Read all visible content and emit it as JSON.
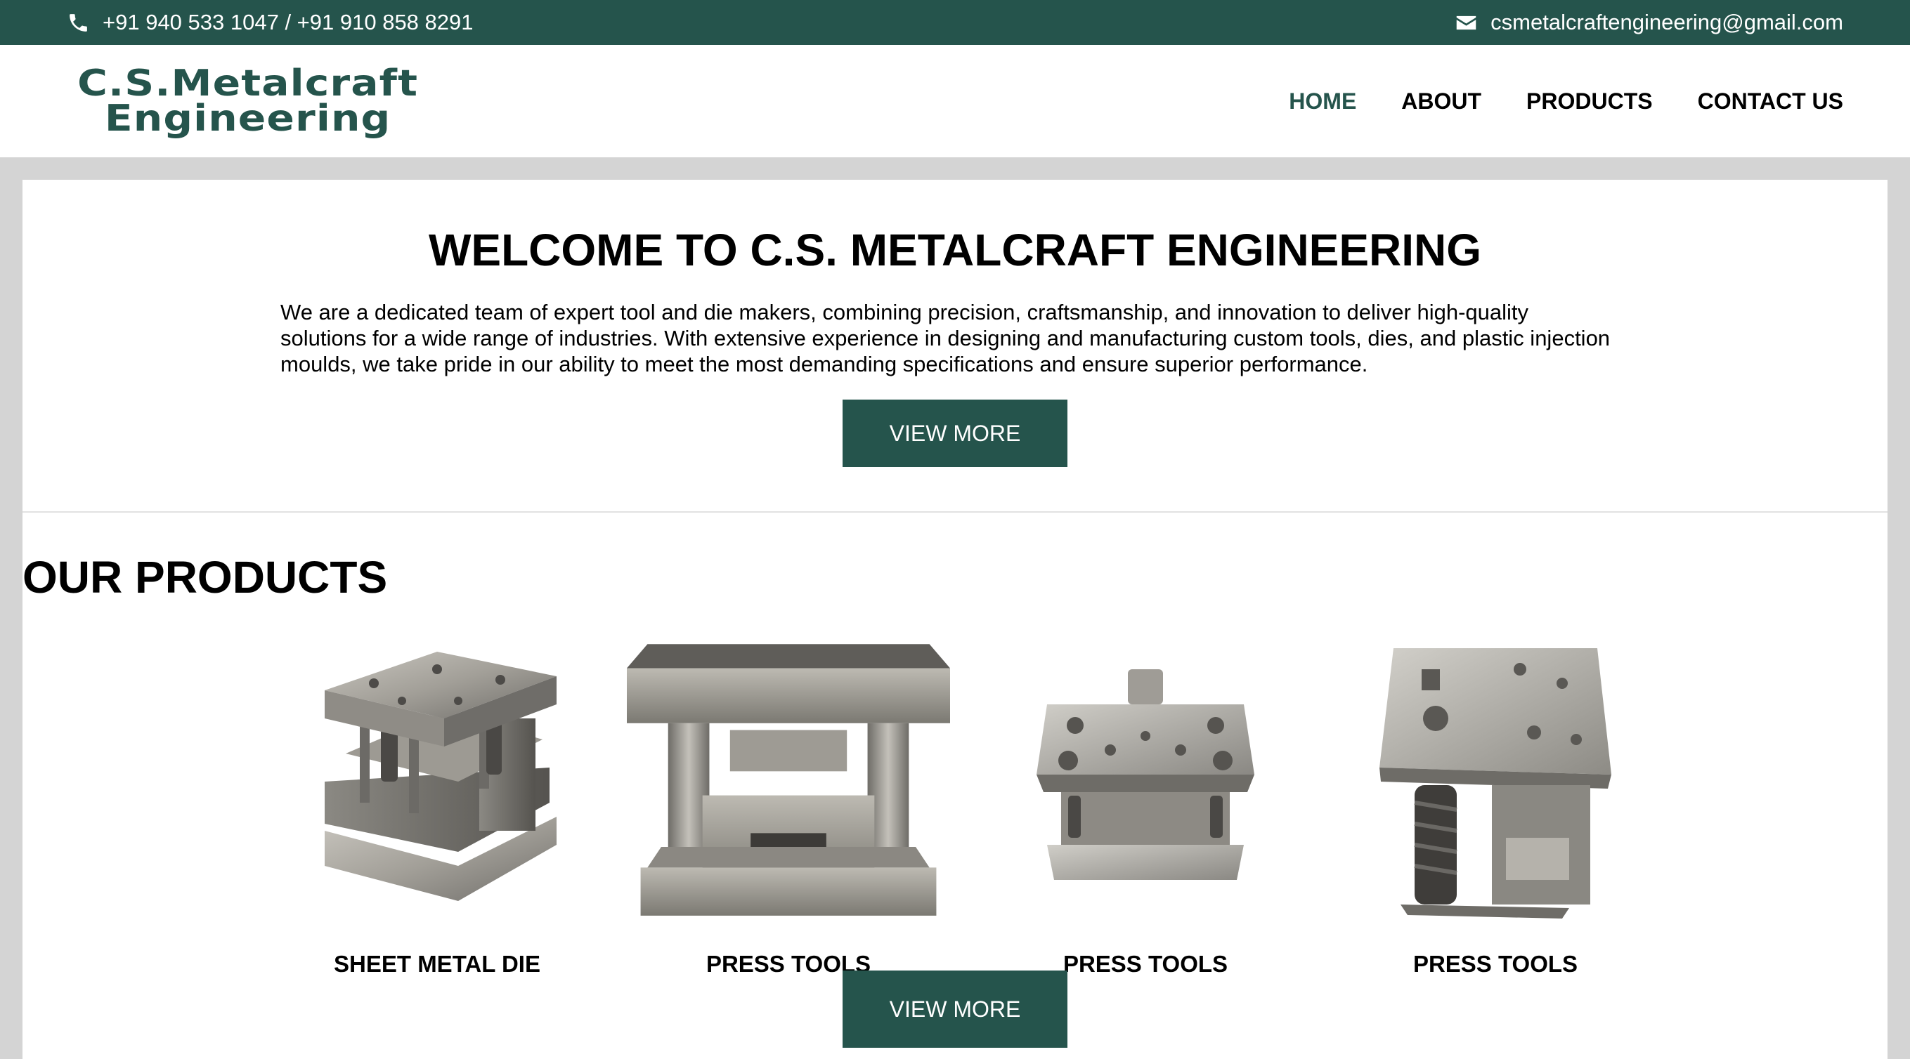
{
  "topbar": {
    "phone": "+91 940 533 1047 / +91 910 858 8291",
    "email": "csmetalcraftengineering@gmail.com",
    "phone_icon": "phone-icon",
    "email_icon": "envelope-icon"
  },
  "logo": {
    "line1": "C.S.Metalcraft",
    "line2": "Engineering"
  },
  "nav": [
    "HOME",
    "ABOUT",
    "PRODUCTS",
    "CONTACT US"
  ],
  "welcome": {
    "title": "WELCOME TO C.S. METALCRAFT ENGINEERING",
    "text": "We are a dedicated team of expert tool and die makers, combining precision, craftsmanship, and innovation to deliver high-quality solutions for a wide range of industries. With extensive experience in designing and manufacturing custom tools, dies, and plastic injection moulds, we take pride in our ability to meet the most demanding specifications and ensure superior performance.",
    "button": "VIEW MORE"
  },
  "products": {
    "title": "OUR PRODUCTS",
    "items": [
      {
        "name": "SHEET METAL DIE"
      },
      {
        "name": "PRESS TOOLS"
      },
      {
        "name": "PRESS TOOLS"
      },
      {
        "name": "PRESS TOOLS"
      }
    ],
    "button": "VIEW MORE"
  },
  "colors": {
    "brand": "#25544c",
    "nav_active": "#25544c"
  }
}
